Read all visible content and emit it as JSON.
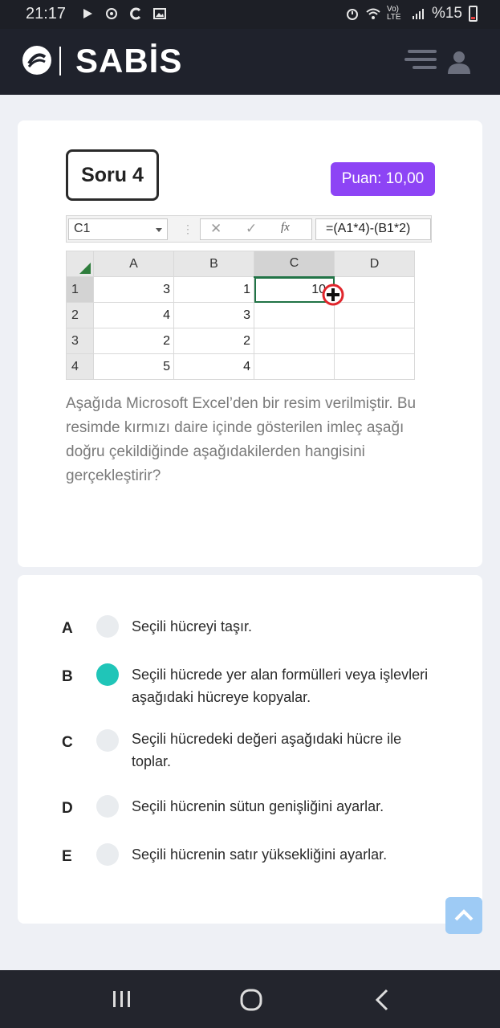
{
  "status_bar": {
    "time": "21:17",
    "battery": "%15",
    "network": "Vo) LTE"
  },
  "app": {
    "brand": "SABİS"
  },
  "question": {
    "title": "Soru 4",
    "score": "Puan: 10,00",
    "text": "Aşağıda Microsoft Excel’den bir resim verilmiştir. Bu resimde kırmızı daire içinde gösterilen imleç aşağı doğru çekildiğinde aşağıdakilerden hangisini gerçekleştirir?"
  },
  "excel": {
    "name_box": "C1",
    "formula": "=(A1*4)-(B1*2)",
    "fx_label": "fx",
    "columns": [
      "A",
      "B",
      "C",
      "D"
    ],
    "rows": [
      {
        "num": "1",
        "a": "3",
        "b": "1",
        "c": "10",
        "d": ""
      },
      {
        "num": "2",
        "a": "4",
        "b": "3",
        "c": "",
        "d": ""
      },
      {
        "num": "3",
        "a": "2",
        "b": "2",
        "c": "",
        "d": ""
      },
      {
        "num": "4",
        "a": "5",
        "b": "4",
        "c": "",
        "d": ""
      }
    ]
  },
  "options": [
    {
      "letter": "A",
      "text": "Seçili hücreyi taşır.",
      "selected": false
    },
    {
      "letter": "B",
      "text": "Seçili hücrede yer alan formülleri veya işlevleri aşağıdaki hücreye kopyalar.",
      "selected": true
    },
    {
      "letter": "C",
      "text": "Seçili hücredeki değeri aşağıdaki hücre ile toplar.",
      "selected": false
    },
    {
      "letter": "D",
      "text": "Seçili hücrenin sütun genişliğini ayarlar.",
      "selected": false
    },
    {
      "letter": "E",
      "text": "Seçili hücrenin satır yüksekliğini ayarlar.",
      "selected": false
    }
  ],
  "colors": {
    "accent_purple": "#8d44f5",
    "selected_radio": "#20c5b8",
    "header_bg": "#1f222c"
  }
}
